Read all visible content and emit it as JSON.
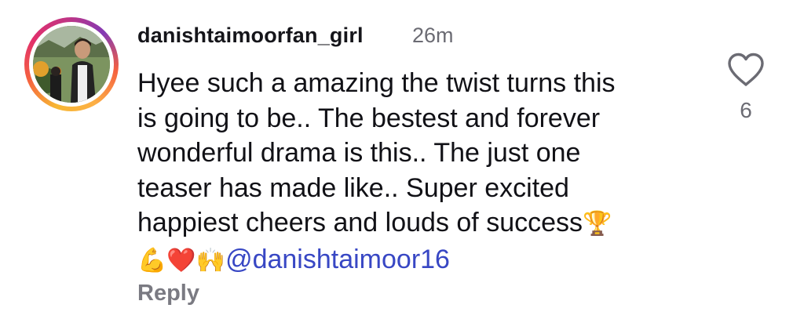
{
  "comment": {
    "username": "danishtaimoorfan_girl",
    "timestamp": "26m",
    "text_lines": [
      "Hyee such a amazing the twist turns this",
      "is going to be.. The bestest and forever",
      "wonderful drama is this.. The just one",
      "teaser has made like.. Super excited",
      "happiest cheers and louds of success"
    ],
    "trophy_emoji": "🏆",
    "emojis": "💪❤️🙌",
    "mention": "@danishtaimoor16",
    "reply_label": "Reply",
    "like_count": "6",
    "like_icon": "heart-outline-icon",
    "avatar_ring_colors": [
      "#f7b733",
      "#e1306c",
      "#833ab4"
    ],
    "mention_color": "#3847c4"
  }
}
